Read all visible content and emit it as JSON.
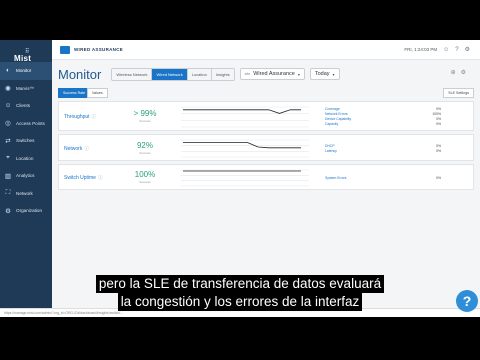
{
  "app": {
    "brand": "Mist",
    "org_name": "WIRED ASSURANCE",
    "top_right_text": "FRI, 1:24:03 PM",
    "status_url": "https://manage.mist.com/admin/?org_id=ORG-ID#!dashboard/insights/switch/..."
  },
  "sidebar": {
    "items": [
      {
        "label": "Monitor",
        "icon": "monitor-icon",
        "glyph": "◐"
      },
      {
        "label": "Marvis™",
        "icon": "marvis-icon",
        "glyph": "◉"
      },
      {
        "label": "Clients",
        "icon": "clients-icon",
        "glyph": "☺"
      },
      {
        "label": "Access Points",
        "icon": "access-points-icon",
        "glyph": "◎"
      },
      {
        "label": "Switches",
        "icon": "switches-icon",
        "glyph": "⇄"
      },
      {
        "label": "Location",
        "icon": "location-icon",
        "glyph": "⌖"
      },
      {
        "label": "Analytics",
        "icon": "analytics-icon",
        "glyph": "▥"
      },
      {
        "label": "Network",
        "icon": "network-icon",
        "glyph": "⛶"
      },
      {
        "label": "Organization",
        "icon": "organization-icon",
        "glyph": "⚙"
      }
    ]
  },
  "header": {
    "title": "Monitor",
    "segments": [
      "Wireless Network",
      "Wired Network",
      "Location",
      "Insights"
    ],
    "active_segment": 1,
    "site_label": "site",
    "site_value": "Wired Assurance",
    "period_value": "Today"
  },
  "tabs": {
    "items": [
      "Success Rate",
      "Values"
    ],
    "settings_label": "SLE Settings"
  },
  "metrics": [
    {
      "name": "Throughput",
      "value": "> 99%",
      "sub": "Success",
      "legend": [
        {
          "label": "Coverage",
          "pct": "0%"
        },
        {
          "label": "Network Errors",
          "pct": "100%"
        },
        {
          "label": "Device Capability",
          "pct": "0%"
        },
        {
          "label": "Capacity",
          "pct": "0%"
        }
      ]
    },
    {
      "name": "Network",
      "value": "92%",
      "sub": "Success",
      "legend": [
        {
          "label": "DHCP",
          "pct": "0%"
        },
        {
          "label": "Latency",
          "pct": "0%"
        }
      ]
    },
    {
      "name": "Switch Uptime",
      "value": "100%",
      "sub": "Success",
      "legend": [
        {
          "label": "System Errors",
          "pct": "0%"
        }
      ]
    }
  ],
  "chart_data": [
    {
      "type": "line",
      "series": [
        {
          "values": [
            99,
            99,
            99,
            99,
            99,
            99,
            99,
            99,
            99,
            97,
            99,
            99
          ]
        }
      ],
      "ylim": [
        90,
        100
      ]
    },
    {
      "type": "line",
      "series": [
        {
          "values": [
            98,
            98,
            98,
            98,
            98,
            98,
            98,
            92,
            91,
            91,
            91,
            91
          ]
        }
      ],
      "ylim": [
        80,
        100
      ]
    },
    {
      "type": "line",
      "series": [
        {
          "values": [
            100,
            100,
            100,
            100,
            100,
            100,
            100,
            100,
            100,
            100,
            100,
            100
          ]
        }
      ],
      "ylim": [
        90,
        100
      ]
    }
  ],
  "subtitle": {
    "line1": "pero la SLE de transferencia de datos evaluará",
    "line2": "la congestión y los errores de la interfaz"
  },
  "help_label": "?"
}
